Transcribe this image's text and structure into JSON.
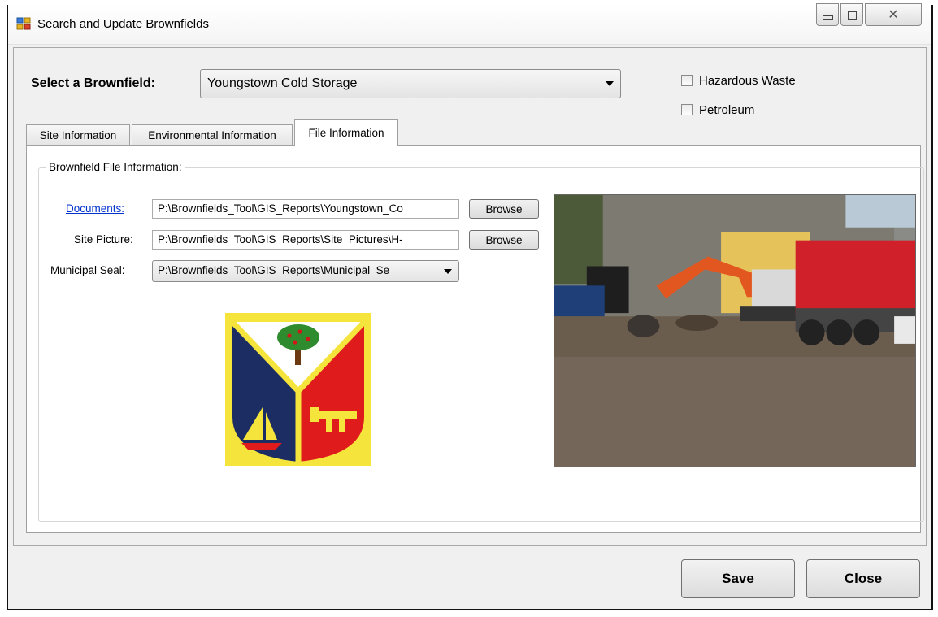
{
  "window": {
    "title": "Search and Update Brownfields",
    "controls": [
      "minimize",
      "restore",
      "close"
    ]
  },
  "select_brownfield": {
    "label": "Select a Brownfield:",
    "value": "Youngstown Cold Storage"
  },
  "checkboxes": [
    {
      "label": "Hazardous Waste",
      "checked": false
    },
    {
      "label": "Petroleum",
      "checked": false
    }
  ],
  "tabs": [
    {
      "label": "Site Information",
      "active": false
    },
    {
      "label": "Environmental Information",
      "active": false
    },
    {
      "label": "File Information",
      "active": true
    }
  ],
  "file_info": {
    "group_label": "Brownfield File Information:",
    "documents": {
      "label": "Documents:",
      "value": "P:\\Brownfields_Tool\\GIS_Reports\\Youngstown_Co",
      "button": "Browse"
    },
    "site_picture": {
      "label": "Site Picture:",
      "value": "P:\\Brownfields_Tool\\GIS_Reports\\Site_Pictures\\H-",
      "button": "Browse"
    },
    "municipal_seal": {
      "label": "Municipal Seal:",
      "value": "P:\\Brownfields_Tool\\GIS_Reports\\Municipal_Se"
    }
  },
  "buttons": {
    "save": "Save",
    "close": "Close"
  },
  "colors": {
    "window_bg": "#f0f0f0",
    "link": "#0033cc",
    "seal_yellow": "#f5e43c",
    "seal_navy": "#1b2d63",
    "seal_red": "#e01b1b"
  }
}
